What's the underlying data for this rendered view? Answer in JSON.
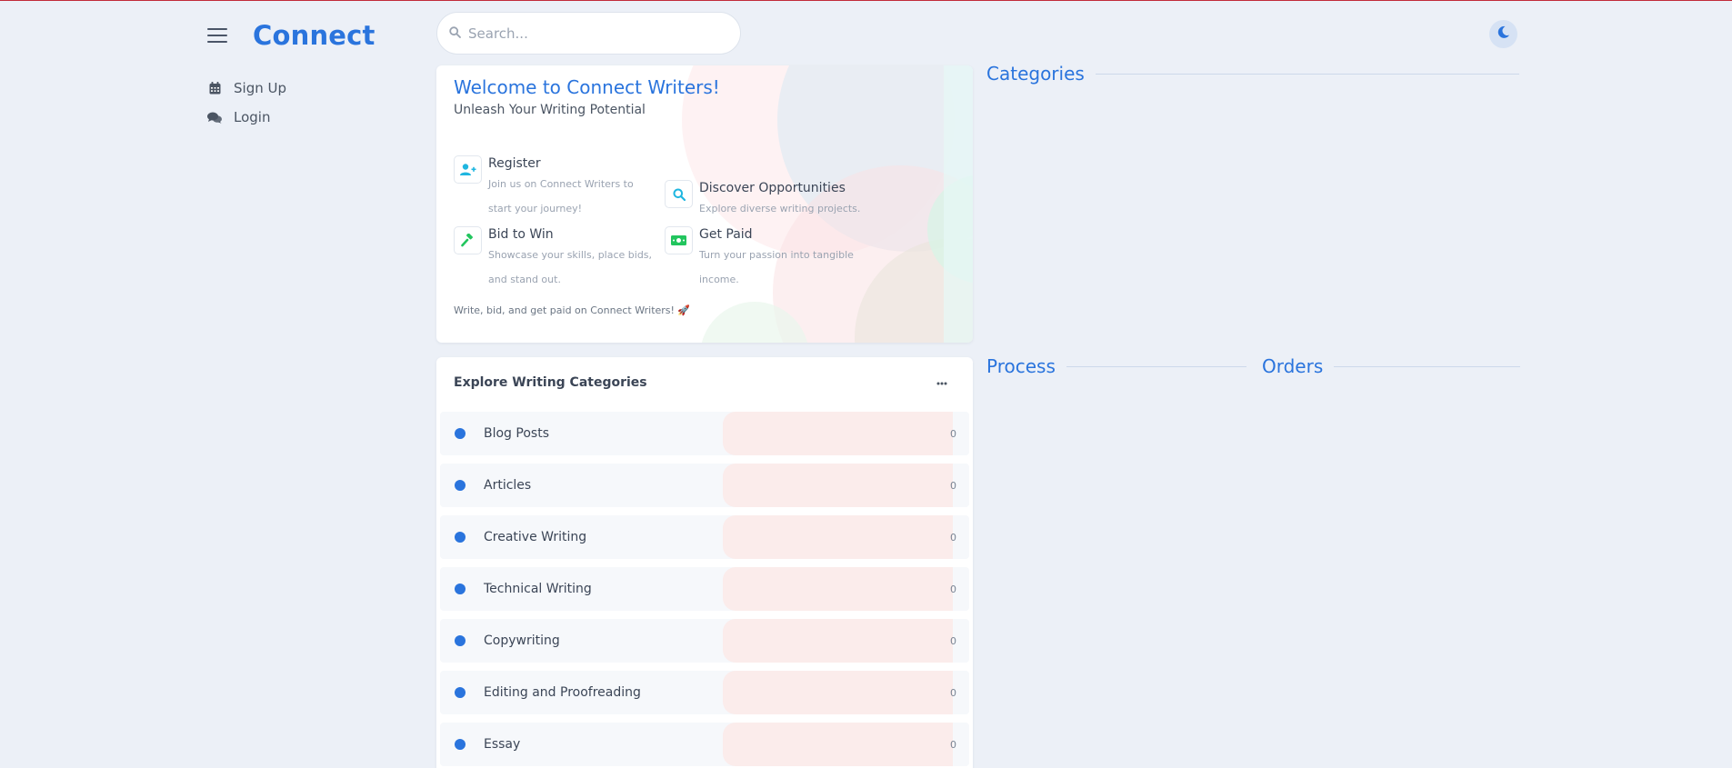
{
  "app": {
    "name": "Connect"
  },
  "nav": {
    "items": [
      {
        "label": "Sign Up",
        "icon": "calendar-icon"
      },
      {
        "label": "Login",
        "icon": "comments-icon"
      }
    ]
  },
  "search": {
    "placeholder": "Search..."
  },
  "welcome": {
    "title": "Welcome to Connect Writers!",
    "subtitle": "Unleash Your Writing Potential",
    "features": [
      {
        "title": "Register",
        "desc": "Join us on Connect Writers to start your journey!",
        "icon": "user-plus-icon"
      },
      {
        "title": "Discover Opportunities",
        "desc": "Explore diverse writing projects.",
        "icon": "search-icon"
      },
      {
        "title": "Bid to Win",
        "desc": "Showcase your skills, place bids, and stand out.",
        "icon": "gavel-icon"
      },
      {
        "title": "Get Paid",
        "desc": "Turn your passion into tangible income.",
        "icon": "money-icon"
      }
    ],
    "footer": "Write, bid, and get paid on Connect Writers! 🚀"
  },
  "sections": {
    "categories": "Categories",
    "process": "Process",
    "orders": "Orders"
  },
  "explore": {
    "title": "Explore Writing Categories",
    "items": [
      {
        "name": "Blog Posts",
        "count": "0"
      },
      {
        "name": "Articles",
        "count": "0"
      },
      {
        "name": "Creative Writing",
        "count": "0"
      },
      {
        "name": "Technical Writing",
        "count": "0"
      },
      {
        "name": "Copywriting",
        "count": "0"
      },
      {
        "name": "Editing and Proofreading",
        "count": "0"
      },
      {
        "name": "Essay",
        "count": "0"
      }
    ]
  },
  "colors": {
    "accent": "#2a74dd",
    "background": "#ecf0f7",
    "top_border": "#c22b3a",
    "icon_cyan": "#1fb6e0",
    "icon_green": "#22c55e"
  }
}
